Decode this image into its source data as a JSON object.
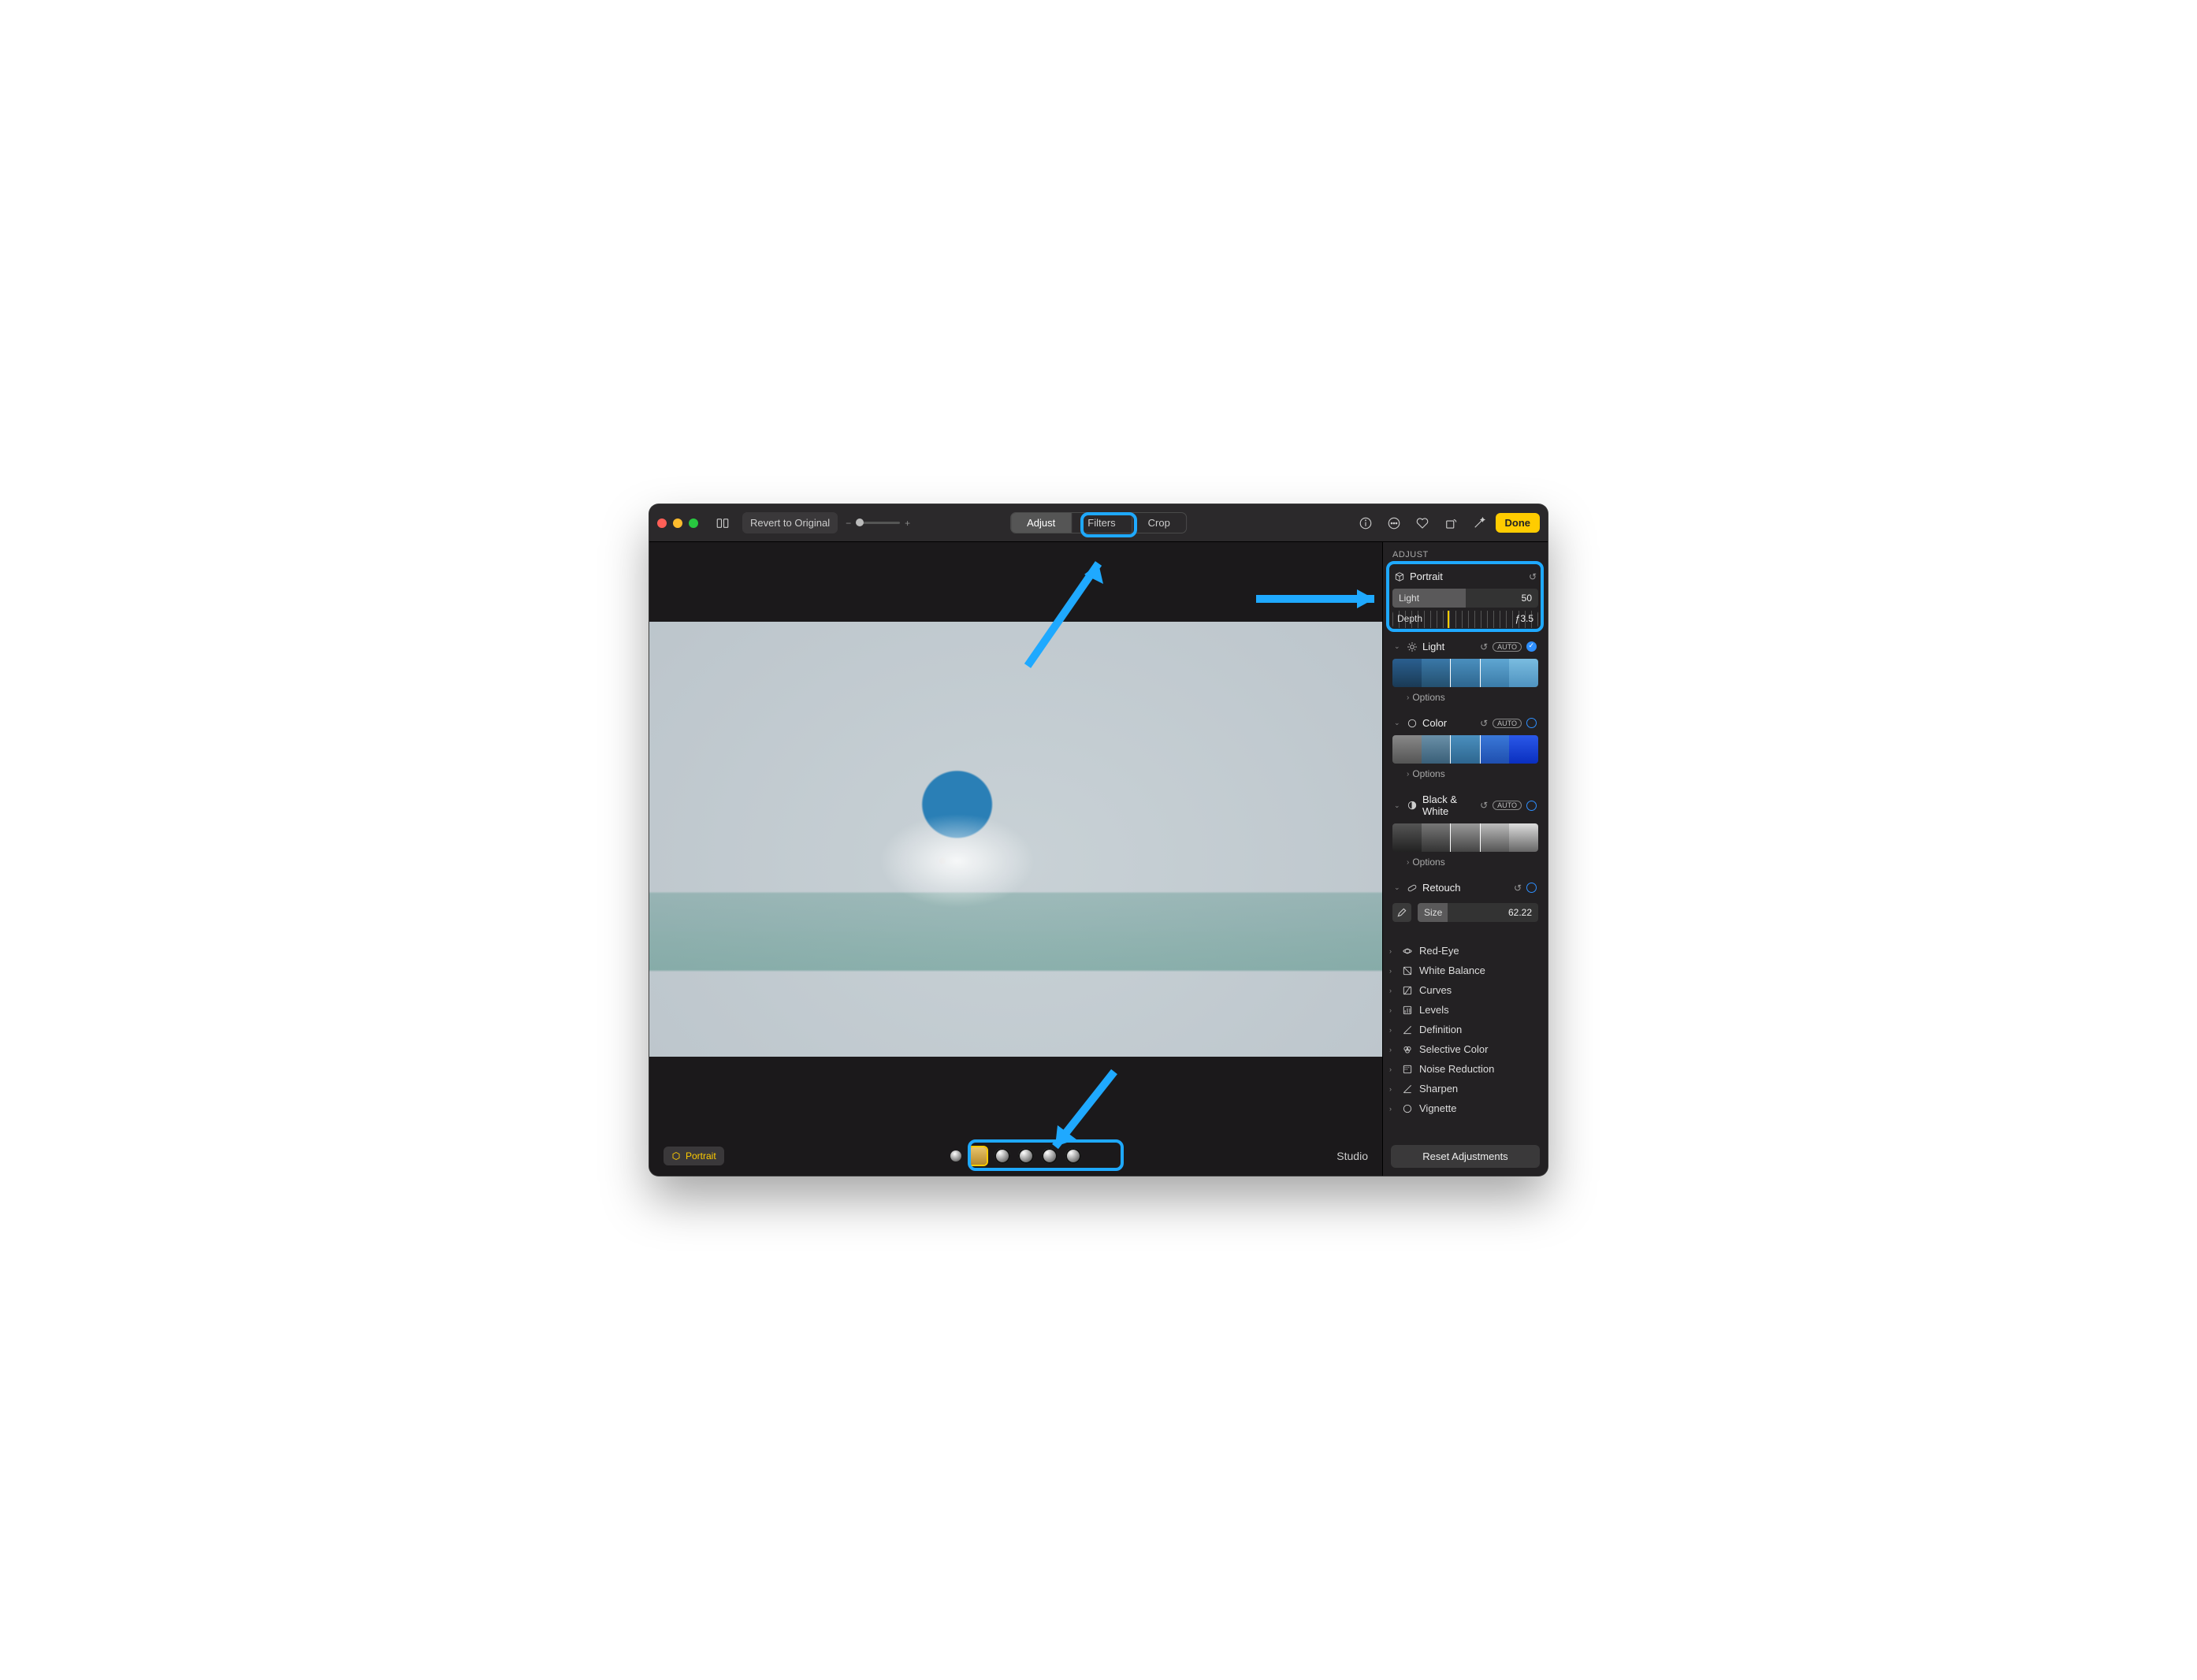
{
  "toolbar": {
    "revert_label": "Revert to Original",
    "zoom_minus": "−",
    "zoom_plus": "+",
    "done_label": "Done"
  },
  "tabs": {
    "adjust": "Adjust",
    "filters": "Filters",
    "crop": "Crop",
    "active": "Adjust"
  },
  "sidebar": {
    "title": "ADJUST",
    "portrait": {
      "name": "Portrait",
      "light_label": "Light",
      "light_value": "50",
      "light_fill_pct": 50,
      "depth_label": "Depth",
      "depth_value": "ƒ3.5",
      "depth_marker_pct": 38
    },
    "light": {
      "name": "Light",
      "auto": "AUTO",
      "options": "Options",
      "enabled": true
    },
    "color": {
      "name": "Color",
      "auto": "AUTO",
      "options": "Options",
      "enabled": false
    },
    "bw": {
      "name": "Black & White",
      "auto": "AUTO",
      "options": "Options",
      "enabled": false
    },
    "retouch": {
      "name": "Retouch",
      "size_label": "Size",
      "size_value": "62.22",
      "size_fill_pct": 25
    },
    "collapsed": [
      "Red-Eye",
      "White Balance",
      "Curves",
      "Levels",
      "Definition",
      "Selective Color",
      "Noise Reduction",
      "Sharpen",
      "Vignette"
    ],
    "reset_label": "Reset Adjustments"
  },
  "bottom": {
    "portrait_chip": "Portrait",
    "lighting_name": "Studio"
  },
  "icons": {
    "compare": "compare-icon",
    "info": "info-icon",
    "more": "more-icon",
    "favorite": "heart-icon",
    "rotate": "rotate-icon",
    "wand": "wand-icon",
    "cube": "cube-icon",
    "sun": "sun-icon",
    "palette": "palette-icon",
    "bw": "bw-icon",
    "bandaid": "bandaid-icon",
    "eye": "eye-icon",
    "wb": "wb-icon",
    "curves": "curves-icon",
    "levels": "levels-icon",
    "definition": "definition-icon",
    "selcolor": "selcolor-icon",
    "noise": "noise-icon",
    "sharpen": "sharpen-icon",
    "vignette": "vignette-icon"
  }
}
